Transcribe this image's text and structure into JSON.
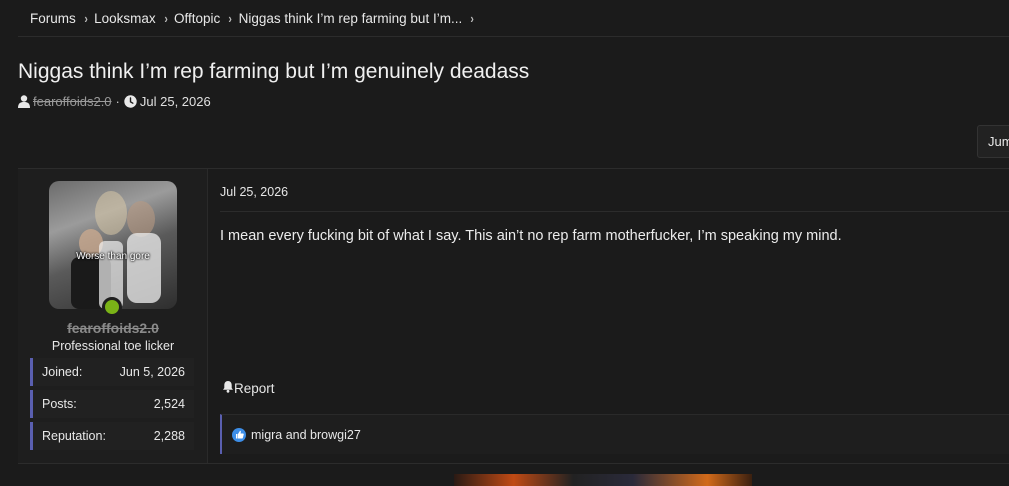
{
  "breadcrumb": [
    {
      "label": "Forums"
    },
    {
      "label": "Looksmax"
    },
    {
      "label": "Offtopic"
    },
    {
      "label": "Niggas think I’m rep farming but I’m..."
    }
  ],
  "thread": {
    "title": "Niggas think I’m rep farming but I’m genuinely deadass",
    "author": "fearoffoids2.0",
    "separator": "·",
    "date": "Jul 25, 2026"
  },
  "jump_button": {
    "label": "Jum"
  },
  "post": {
    "user": {
      "avatar_caption": "Worse than gore",
      "username": "fearoffoids2.0",
      "user_title": "Professional toe licker",
      "stats": [
        {
          "label": "Joined:",
          "value": "Jun 5, 2026"
        },
        {
          "label": "Posts:",
          "value": "2,524"
        },
        {
          "label": "Reputation:",
          "value": "2,288"
        }
      ]
    },
    "date": "Jul 25, 2026",
    "body": "I mean every fucking bit of what I say. This ain’t no rep farm motherfucker, I’m speaking my mind.",
    "report_label": "Report",
    "reactions_text": "migra and browgi27"
  },
  "colors": {
    "background": "#1b1b1b",
    "accent": "#5a5fb0",
    "online": "#7ab317",
    "like": "#3d8ee8"
  },
  "icons": {
    "breadcrumb_separator": "chevron-right-icon",
    "author": "user-icon",
    "date": "clock-icon",
    "report": "bell-icon",
    "reaction": "thumbs-up-icon"
  }
}
